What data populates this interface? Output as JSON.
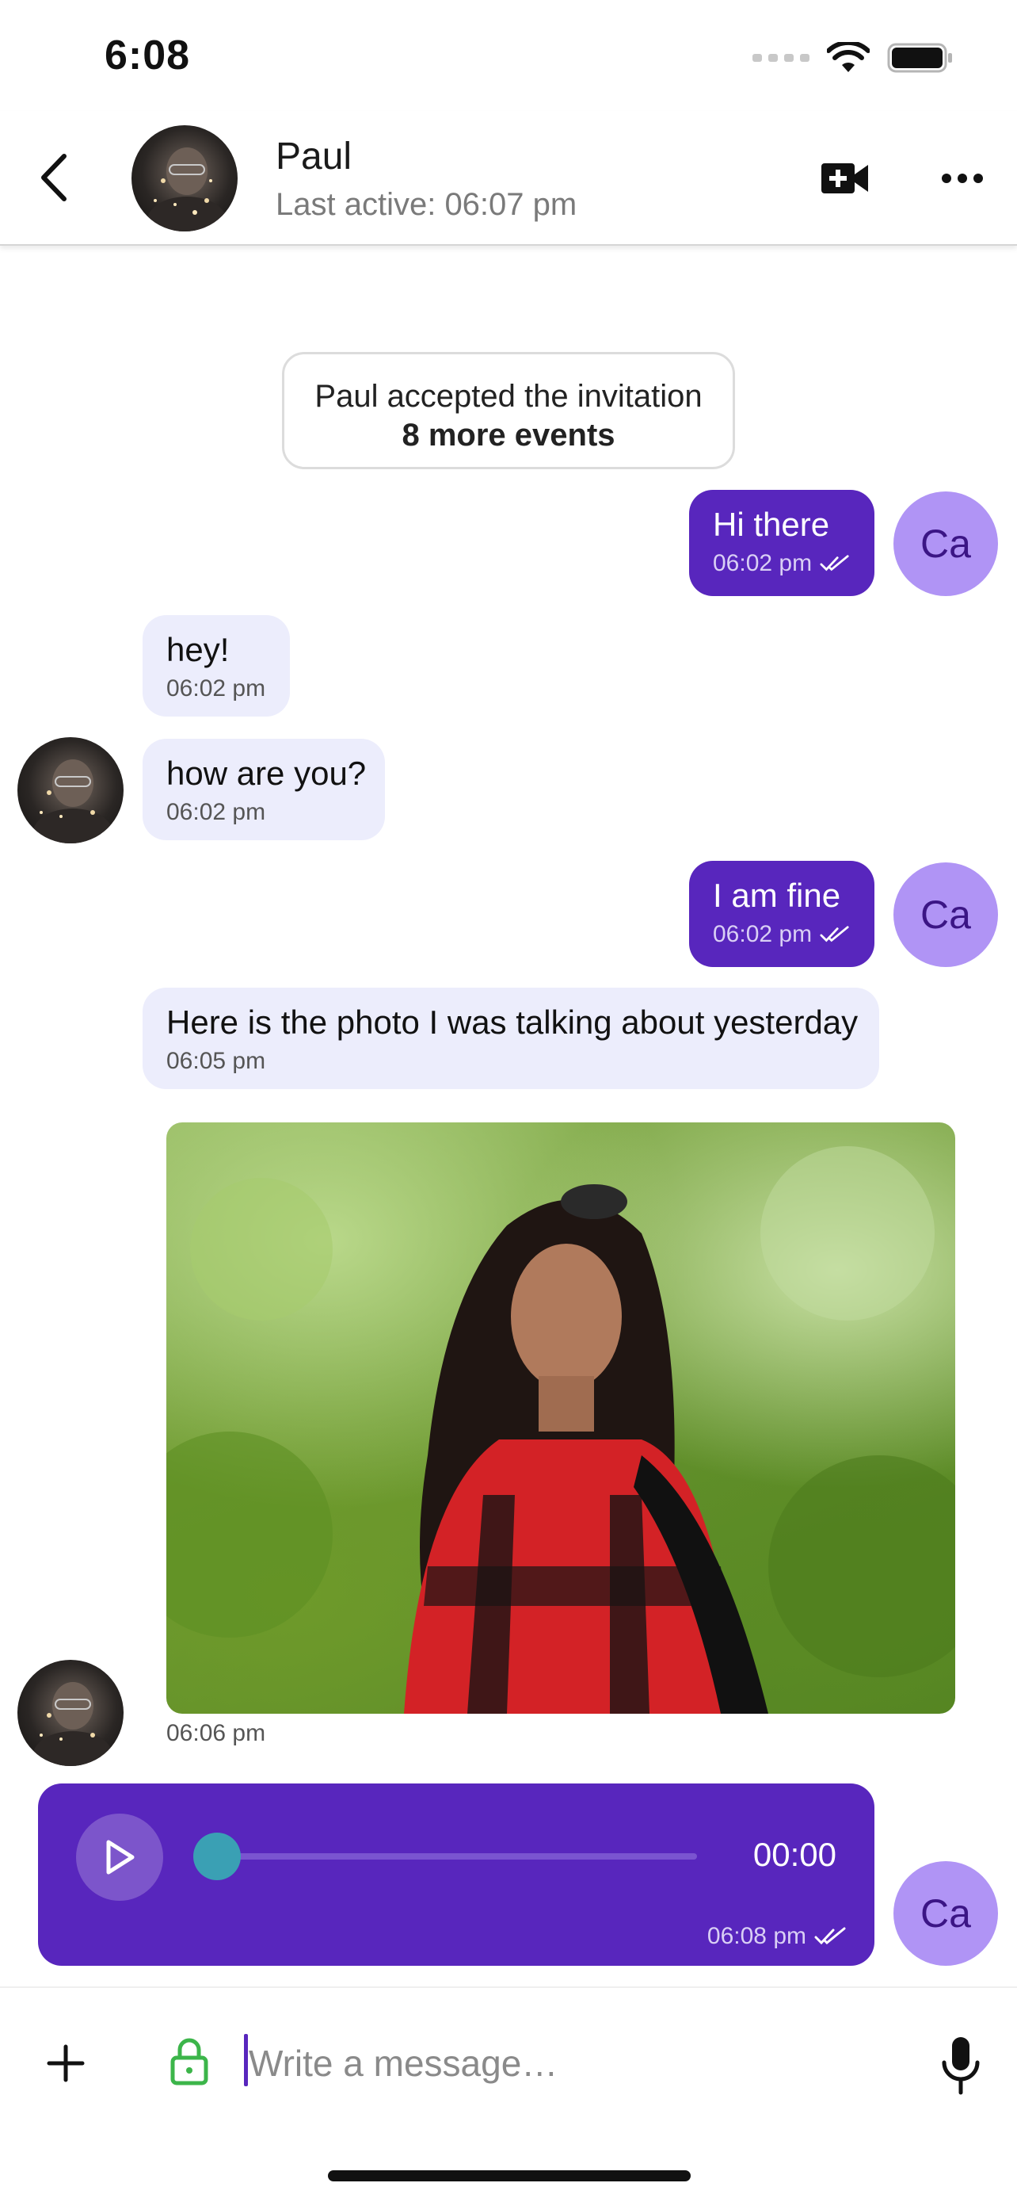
{
  "status_bar": {
    "time": "6:08"
  },
  "header": {
    "contact_name": "Paul",
    "last_active": "Last active: 06:07 pm"
  },
  "event": {
    "text": "Paul accepted the invitation",
    "more": "8 more events"
  },
  "user_initials": "Ca",
  "messages": [
    {
      "direction": "out",
      "text": "Hi there",
      "time": "06:02 pm",
      "read": true
    },
    {
      "direction": "in",
      "text": "hey!",
      "time": "06:02 pm"
    },
    {
      "direction": "in",
      "text": "how are you?",
      "time": "06:02 pm"
    },
    {
      "direction": "out",
      "text": "I am fine",
      "time": "06:02 pm",
      "read": true
    },
    {
      "direction": "in",
      "text": "Here is the photo I was talking about yesterday",
      "time": "06:05 pm"
    },
    {
      "direction": "in",
      "type": "photo",
      "time": "06:06 pm"
    },
    {
      "direction": "out",
      "type": "voice",
      "duration": "00:00",
      "progress": 0,
      "time": "06:08 pm",
      "read": true
    }
  ],
  "composer": {
    "placeholder": "Write a message…"
  },
  "colors": {
    "accent": "#5826bd",
    "incoming_bubble": "#ecedfc",
    "user_avatar": "#b094f5",
    "lock_icon": "#3cb54a",
    "audio_knob": "#3aa0b4"
  }
}
